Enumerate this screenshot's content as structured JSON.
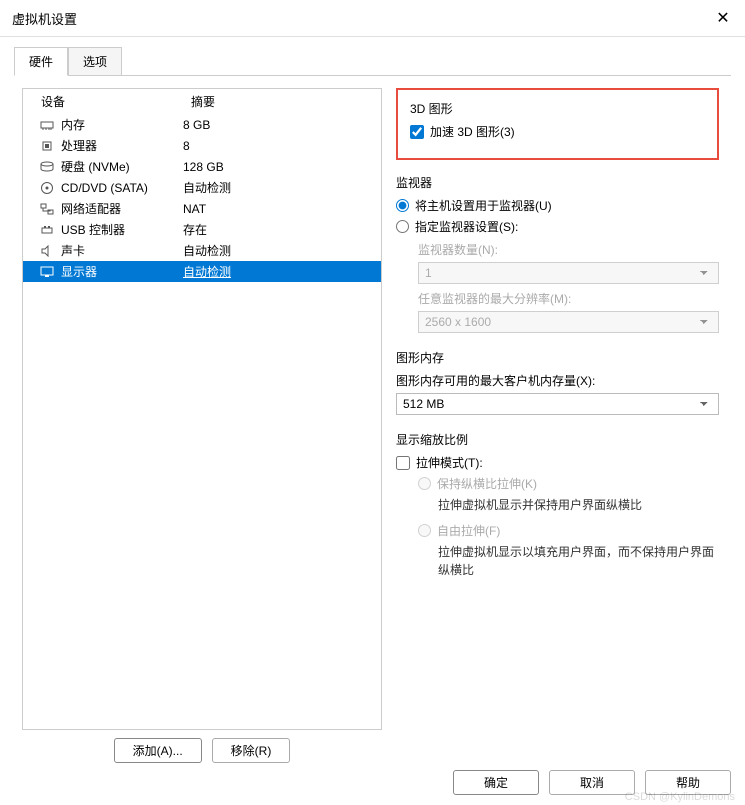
{
  "window": {
    "title": "虚拟机设置"
  },
  "tabs": {
    "hardware": "硬件",
    "options": "选项"
  },
  "deviceList": {
    "header_device": "设备",
    "header_summary": "摘要",
    "rows": [
      {
        "name": "内存",
        "summary": "8 GB"
      },
      {
        "name": "处理器",
        "summary": "8"
      },
      {
        "name": "硬盘 (NVMe)",
        "summary": "128 GB"
      },
      {
        "name": "CD/DVD (SATA)",
        "summary": "自动检测"
      },
      {
        "name": "网络适配器",
        "summary": "NAT"
      },
      {
        "name": "USB 控制器",
        "summary": "存在"
      },
      {
        "name": "声卡",
        "summary": "自动检测"
      },
      {
        "name": "显示器",
        "summary": "自动检测"
      }
    ]
  },
  "leftButtons": {
    "add": "添加(A)...",
    "remove": "移除(R)"
  },
  "section3d": {
    "title": "3D 图形",
    "accelerate": "加速 3D 图形(3)"
  },
  "sectionMonitor": {
    "title": "监视器",
    "useHost": "将主机设置用于监视器(U)",
    "specify": "指定监视器设置(S):",
    "countLabel": "监视器数量(N):",
    "countValue": "1",
    "maxResLabel": "任意监视器的最大分辨率(M):",
    "maxResValue": "2560 x 1600"
  },
  "sectionGraphicsMem": {
    "title": "图形内存",
    "label": "图形内存可用的最大客户机内存量(X):",
    "value": "512 MB"
  },
  "sectionScale": {
    "title": "显示缩放比例",
    "stretchMode": "拉伸模式(T):",
    "keepAspect": "保持纵横比拉伸(K)",
    "keepAspectDesc": "拉伸虚拟机显示并保持用户界面纵横比",
    "freeStretch": "自由拉伸(F)",
    "freeStretchDesc": "拉伸虚拟机显示以填充用户界面，而不保持用户界面纵横比"
  },
  "footer": {
    "ok": "确定",
    "cancel": "取消",
    "help": "帮助"
  },
  "watermark": "CSDN @KylinDemons"
}
